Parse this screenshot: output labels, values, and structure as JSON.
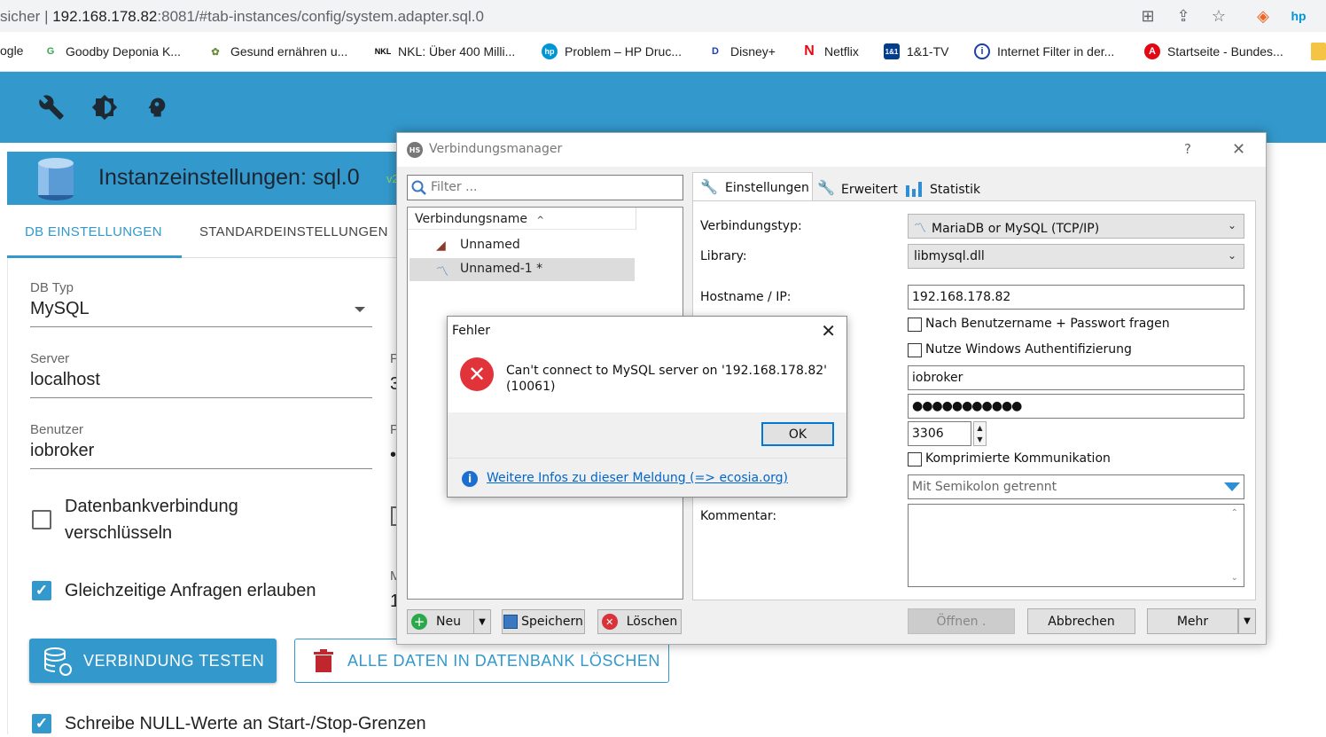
{
  "browser": {
    "url_prefix": "sicher | ",
    "url_host": "192.168.178.82",
    "url_rest": ":8081/#tab-instances/config/system.adapter.sql.0",
    "bookmarks": [
      {
        "label": "ogle"
      },
      {
        "label": "Goodby Deponia K..."
      },
      {
        "label": "Gesund ernähren u..."
      },
      {
        "label": "NKL: Über 400 Milli..."
      },
      {
        "label": "Problem – HP Druc..."
      },
      {
        "label": "Disney+"
      },
      {
        "label": "Netflix"
      },
      {
        "label": "1&1-TV"
      },
      {
        "label": "Internet Filter in der..."
      },
      {
        "label": "Startseite - Bundes..."
      }
    ]
  },
  "instance": {
    "title": "Instanzeinstellungen: sql.0",
    "version": "v2",
    "tabs": [
      "DB EINSTELLUNGEN",
      "STANDARDEINSTELLUNGEN"
    ],
    "db_type_label": "DB Typ",
    "db_type_value": "MySQL",
    "server_label": "Server",
    "server_value": "localhost",
    "user_label": "Benutzer",
    "user_value": "iobroker",
    "port_label_cut": "P",
    "port_value_cut": "3",
    "pass_label_cut": "P",
    "pass_value_cut": "•",
    "max_label_cut": "M",
    "max_value_cut": "1",
    "encrypt_label": "Datenbankverbindung verschlüsseln",
    "parallel_label": "Gleichzeitige Anfragen erlauben",
    "test_button": "VERBINDUNG TESTEN",
    "delete_button": "ALLE DATEN IN DATENBANK LÖSCHEN",
    "null_label": "Schreibe NULL-Werte an Start-/Stop-Grenzen"
  },
  "heidisql": {
    "title": "Verbindungsmanager",
    "help": "?",
    "close": "✕",
    "filter_placeholder": "Filter ...",
    "tree_header": "Verbindungsname",
    "sessions": [
      "Unnamed",
      "Unnamed-1 *"
    ],
    "tabs": [
      "Einstellungen",
      "Erweitert",
      "Statistik"
    ],
    "labels": {
      "conn_type": "Verbindungstyp:",
      "library": "Library:",
      "hostname": "Hostname / IP:",
      "comment": "Kommentar:"
    },
    "conn_type_value": "MariaDB or MySQL (TCP/IP)",
    "library_value": "libmysql.dll",
    "hostname_value": "192.168.178.82",
    "ask_credentials": "Nach Benutzername + Passwort fragen",
    "windows_auth": "Nutze Windows Authentifizierung",
    "user_value": "iobroker",
    "password_value": "●●●●●●●●●●●",
    "port_value": "3306",
    "compressed": "Komprimierte Kommunikation",
    "databases_value": "Mit Semikolon getrennt",
    "buttons": {
      "new": "Neu",
      "save": "Speichern",
      "delete": "Löschen",
      "open": "Öffnen .",
      "cancel": "Abbrechen",
      "more": "Mehr"
    }
  },
  "error_dialog": {
    "title": "Fehler",
    "message": "Can't connect to MySQL server on '192.168.178.82' (10061)",
    "ok": "OK",
    "link": "Weitere Infos zu dieser Meldung (=> ecosia.org)"
  },
  "colors": {
    "iobroker_blue": "#3399cc",
    "error_red": "#e0343a",
    "link_blue": "#0066cc"
  }
}
